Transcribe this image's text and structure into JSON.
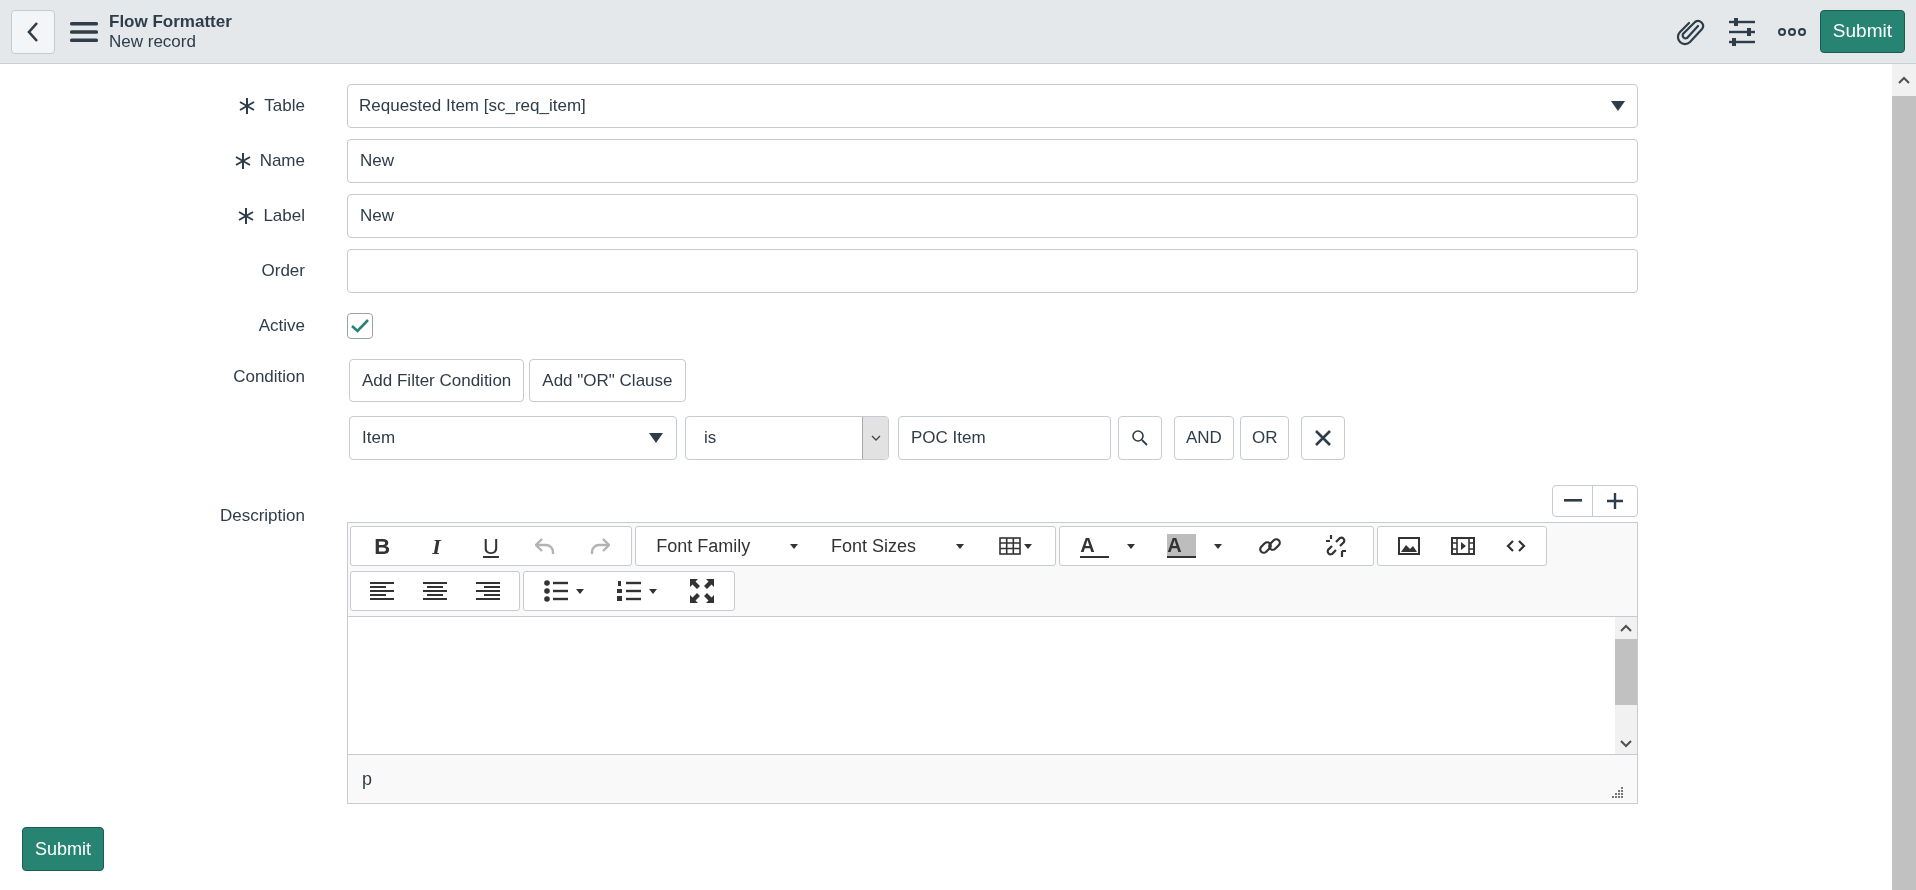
{
  "header": {
    "title": "Flow Formatter",
    "subtitle": "New record",
    "submit": "Submit"
  },
  "fields": [
    {
      "label": "Table",
      "required": true,
      "kind": "select",
      "value": "Requested Item [sc_req_item]"
    },
    {
      "label": "Name",
      "required": true,
      "kind": "text",
      "value": "New"
    },
    {
      "label": "Label",
      "required": true,
      "kind": "text",
      "value": "New"
    },
    {
      "label": "Order",
      "required": false,
      "kind": "text"
    },
    {
      "label": "Active",
      "required": false,
      "kind": "checkbox",
      "checked": true
    }
  ],
  "condition": {
    "label": "Condition",
    "buttons": [
      "Add Filter Condition",
      "Add \"OR\" Clause"
    ],
    "field": "Item",
    "operator": "is",
    "value": "POC Item",
    "logic_buttons": [
      "AND",
      "OR"
    ]
  },
  "description": {
    "label": "Description",
    "toolbar": [
      [
        [
          {
            "kind": "bold",
            "label": "B",
            "disabled": false
          },
          {
            "kind": "italic",
            "label": "I",
            "disabled": false
          },
          {
            "kind": "underline",
            "label": "U",
            "disabled": false
          },
          {
            "kind": "undo",
            "disabled": true
          },
          {
            "kind": "redo",
            "disabled": true
          }
        ],
        [
          {
            "kind": "dropdown",
            "label": "Font Family",
            "disabled": false
          },
          {
            "kind": "dropdown",
            "label": "Font Sizes",
            "disabled": false
          },
          {
            "kind": "table",
            "disabled": false
          }
        ],
        [
          {
            "kind": "forecolor",
            "label": "A",
            "disabled": false
          },
          {
            "kind": "backcolor",
            "label": "A",
            "disabled": false
          },
          {
            "kind": "link",
            "disabled": false
          },
          {
            "kind": "unlink",
            "disabled": false
          }
        ],
        [
          {
            "kind": "image",
            "disabled": false
          },
          {
            "kind": "media",
            "disabled": false
          },
          {
            "kind": "code",
            "disabled": false
          }
        ]
      ],
      [
        [
          {
            "kind": "align_left",
            "disabled": false
          },
          {
            "kind": "align_center",
            "disabled": false
          },
          {
            "kind": "align_right",
            "disabled": false
          }
        ],
        [
          {
            "kind": "bullist",
            "disabled": false
          },
          {
            "kind": "numlist",
            "disabled": false
          },
          {
            "kind": "fullscreen",
            "disabled": false
          }
        ]
      ]
    ],
    "status": "p"
  },
  "footer_submit": "Submit"
}
